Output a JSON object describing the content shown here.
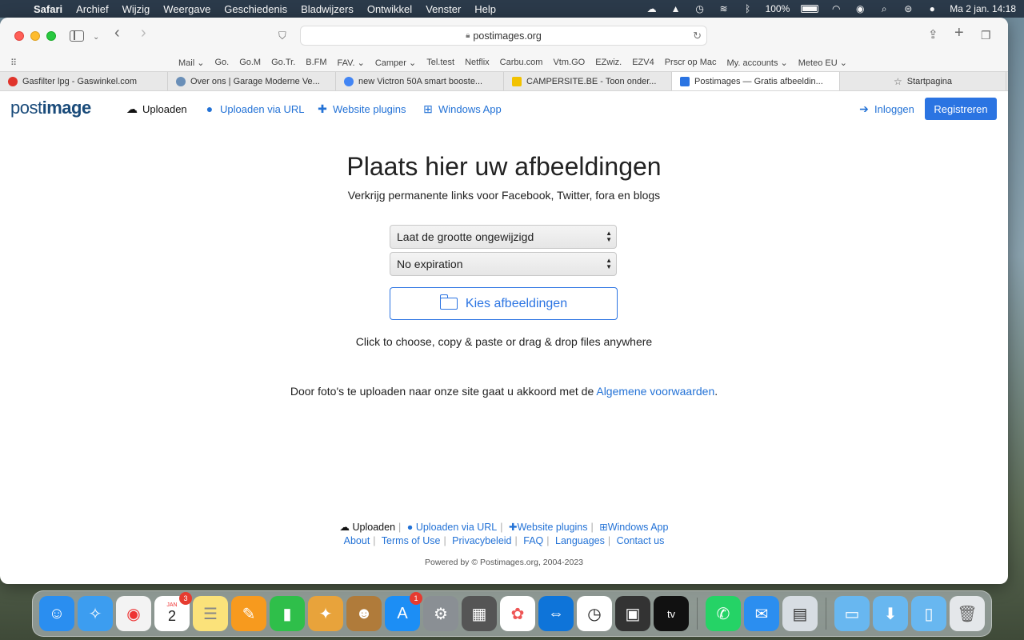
{
  "menubar": {
    "items": [
      "Safari",
      "Archief",
      "Wijzig",
      "Weergave",
      "Geschiedenis",
      "Bladwijzers",
      "Ontwikkel",
      "Venster",
      "Help"
    ],
    "battery": "100%",
    "datetime": "Ma 2 jan.  14:18"
  },
  "browser": {
    "url": "postimages.org",
    "favorites": [
      "Mail ⌄",
      "Go.",
      "Go.M",
      "Go.Tr.",
      "B.FM",
      "FAV. ⌄",
      "Camper ⌄",
      "Tel.test",
      "Netflix",
      "Carbu.com",
      "Vtm.GO",
      "EZwiz.",
      "EZV4",
      "Prscr op Mac",
      "My. accounts ⌄",
      "Meteo EU ⌄"
    ],
    "tabs": [
      {
        "label": "Gasfilter lpg - Gaswinkel.com",
        "color": "#e0342b"
      },
      {
        "label": "Over ons | Garage Moderne Ve...",
        "color": "#6a8fb8"
      },
      {
        "label": "new Victron 50A smart booste...",
        "color": "#4285f4"
      },
      {
        "label": "CAMPERSITE.BE - Toon onder...",
        "color": "#f2c200"
      },
      {
        "label": "Postimages — Gratis afbeeldin...",
        "color": "#2b74e2"
      },
      {
        "label": "Startpagina",
        "color": "#888888"
      }
    ]
  },
  "site": {
    "logo_light": "post",
    "logo_bold": "image",
    "nav": {
      "upload": "Uploaden",
      "upload_url": "Uploaden via URL",
      "plugins": "Website plugins",
      "windows": "Windows App",
      "login": "Inloggen",
      "register": "Registreren"
    },
    "title": "Plaats hier uw afbeeldingen",
    "subtitle": "Verkrijg permanente links voor Facebook, Twitter, fora en blogs",
    "size_select": "Laat de grootte ongewijzigd",
    "expiration_select": "No expiration",
    "choose_button": "Kies afbeeldingen",
    "hint": "Click to choose, copy & paste or drag & drop files anywhere",
    "terms_prefix": "Door foto's te uploaden naar onze site gaat u akkoord met de ",
    "terms_link": "Algemene voorwaarden",
    "terms_suffix": ".",
    "footer": {
      "upload": "Uploaden",
      "upload_url": "Uploaden via URL",
      "plugins": "Website plugins",
      "windows": "Windows App",
      "about": "About",
      "terms": "Terms of Use",
      "privacy": "Privacybeleid",
      "faq": "FAQ",
      "languages": "Languages",
      "contact": "Contact us",
      "powered": "Powered by © Postimages.org, 2004-2023"
    }
  },
  "dock": {
    "calendar_month": "JAN",
    "calendar_day": "2",
    "calendar_badge": "3",
    "appstore_badge": "1"
  },
  "colors": {
    "accent": "#2b74e2",
    "link": "#2372d6"
  }
}
